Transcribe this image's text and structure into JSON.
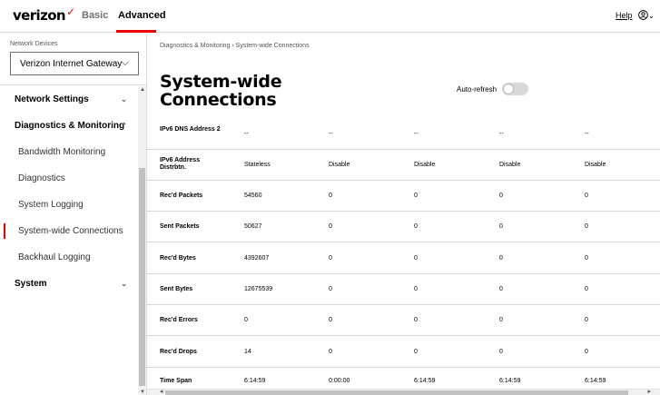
{
  "header": {
    "logo_text": "verizon",
    "logo_mark": "✓",
    "tabs": [
      {
        "label": "Basic"
      },
      {
        "label": "Advanced"
      }
    ],
    "help_label": "Help",
    "accent_color": "#ee0000"
  },
  "sidebar": {
    "device_label": "Network Devices",
    "device_selected": "Verizon Internet Gateway",
    "items": [
      {
        "label": "Network Settings",
        "type": "group"
      },
      {
        "label": "Diagnostics & Monitoring",
        "type": "group"
      },
      {
        "label": "Bandwidth Monitoring",
        "type": "sub"
      },
      {
        "label": "Diagnostics",
        "type": "sub"
      },
      {
        "label": "System Logging",
        "type": "sub"
      },
      {
        "label": "System-wide Connections",
        "type": "sub",
        "active": true
      },
      {
        "label": "Backhaul Logging",
        "type": "sub"
      },
      {
        "label": "System",
        "type": "group"
      }
    ]
  },
  "main": {
    "breadcrumb": "Diagnostics & Monitoring  ›  System-wide Connections",
    "title": "System-wide Connections",
    "auto_refresh_label": "Auto-refresh",
    "auto_refresh_on": false,
    "table": {
      "rows": [
        {
          "label": "IPv6 DNS Address 2",
          "values": [
            "--",
            "--",
            "--",
            "--",
            "--"
          ]
        },
        {
          "label": "IPv6 Address Distrbtn.",
          "values": [
            "Stateless",
            "Disable",
            "Disable",
            "Disable",
            "Disable"
          ]
        },
        {
          "label": "Rec'd Packets",
          "values": [
            "54560",
            "0",
            "0",
            "0",
            "0"
          ]
        },
        {
          "label": "Sent Packets",
          "values": [
            "50627",
            "0",
            "0",
            "0",
            "0"
          ]
        },
        {
          "label": "Rec'd Bytes",
          "values": [
            "4392607",
            "0",
            "0",
            "0",
            "0"
          ]
        },
        {
          "label": "Sent Bytes",
          "values": [
            "12675539",
            "0",
            "0",
            "0",
            "0"
          ]
        },
        {
          "label": "Rec'd Errors",
          "values": [
            "0",
            "0",
            "0",
            "0",
            "0"
          ]
        },
        {
          "label": "Rec'd Drops",
          "values": [
            "14",
            "0",
            "0",
            "0",
            "0"
          ]
        },
        {
          "label": "Time Span",
          "values": [
            "6:14:59",
            "0:00:00",
            "6:14:59",
            "6:14:59",
            "6:14:59"
          ]
        }
      ]
    }
  }
}
